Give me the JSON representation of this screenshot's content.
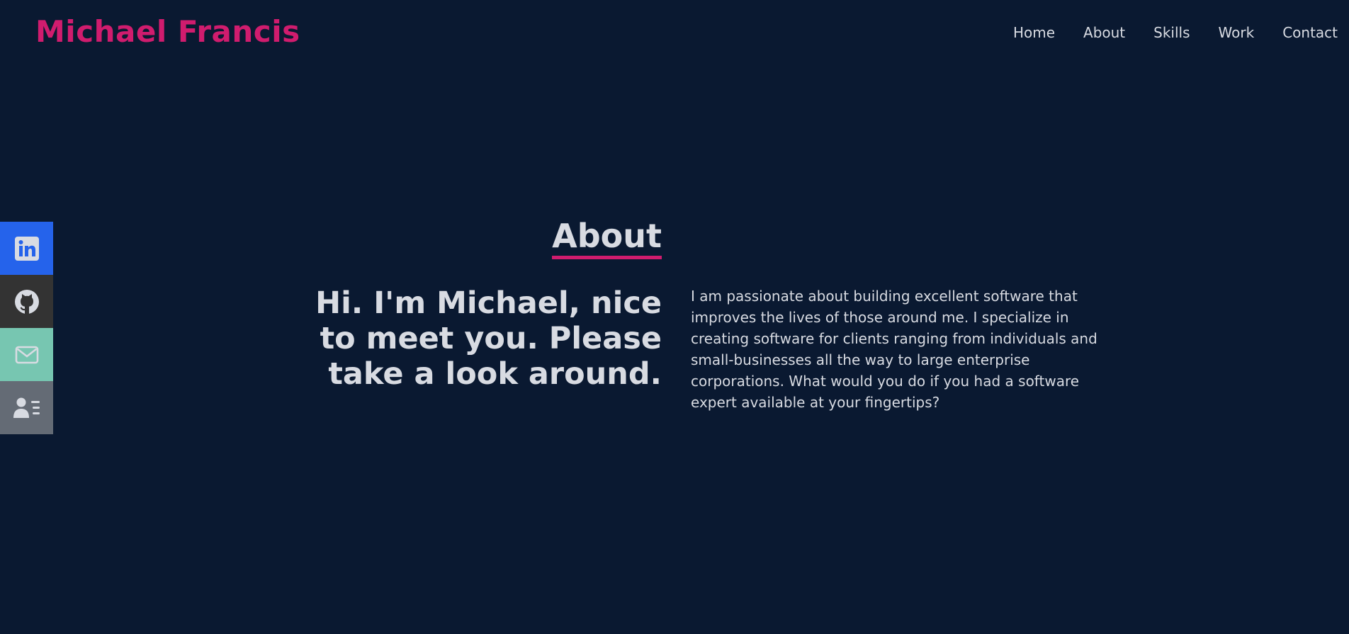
{
  "brand": {
    "name": "Michael Francis",
    "color": "#d01c6e"
  },
  "nav": {
    "items": [
      {
        "label": "Home"
      },
      {
        "label": "About"
      },
      {
        "label": "Skills"
      },
      {
        "label": "Work"
      },
      {
        "label": "Contact"
      }
    ]
  },
  "social": {
    "items": [
      {
        "icon": "linkedin-icon",
        "color": "#2563eb"
      },
      {
        "icon": "github-icon",
        "color": "#333333"
      },
      {
        "icon": "email-icon",
        "color": "#77c6b1"
      },
      {
        "icon": "resume-icon",
        "color": "#646b75"
      }
    ]
  },
  "about": {
    "title": "About",
    "headline": "Hi. I'm Michael, nice to meet you. Please take a look around.",
    "bio": "I am passionate about building excellent software that improves the lives of those around me. I specialize in creating software for clients ranging from individuals and small-businesses all the way to large enterprise corporations. What would you do if you had a software expert available at your fingertips?"
  },
  "colors": {
    "background": "#0a1931",
    "text": "#d8dbe2",
    "accent": "#d01c6e"
  }
}
